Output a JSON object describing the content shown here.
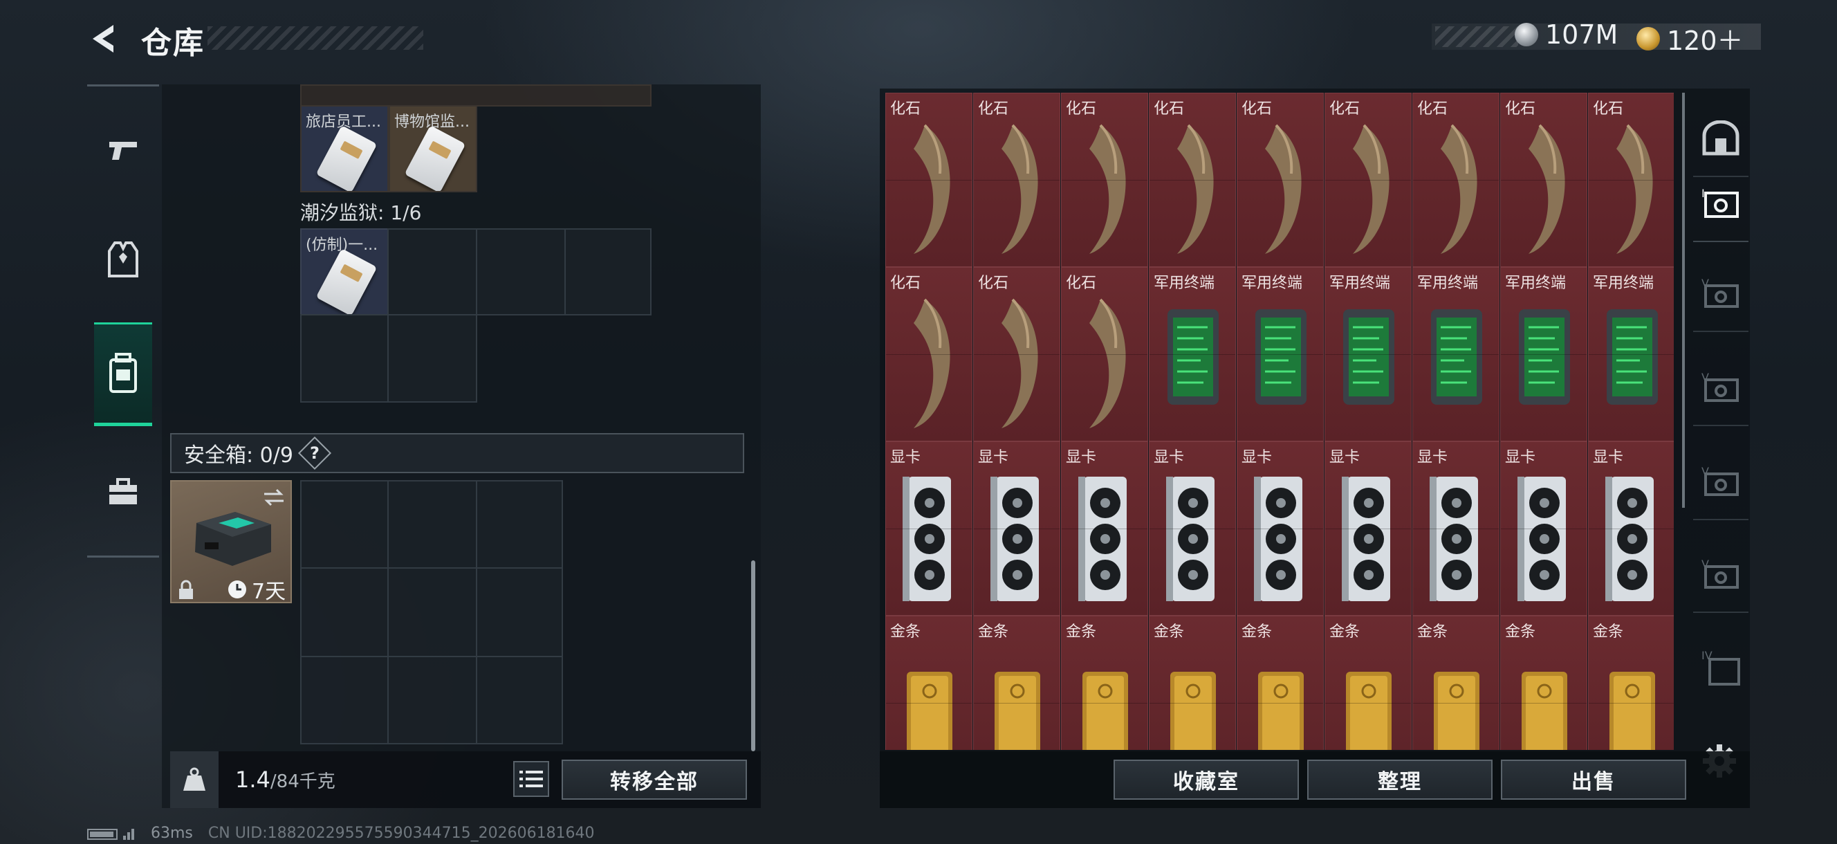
{
  "header": {
    "title": "仓库",
    "currencies": [
      {
        "icon": "silver-coin-icon",
        "value": "107M"
      },
      {
        "icon": "gold-coin-icon",
        "value": "120＋"
      }
    ]
  },
  "left_nav": {
    "items": [
      {
        "name": "weapon",
        "icon": "gun-icon",
        "active": false
      },
      {
        "name": "armor",
        "icon": "armor-vest-icon",
        "active": false
      },
      {
        "name": "backpack",
        "icon": "backpack-icon",
        "active": true
      },
      {
        "name": "toolbox",
        "icon": "toolbox-icon",
        "active": false
      }
    ]
  },
  "keycards": {
    "top_items": [
      {
        "label": "旅店员工..."
      },
      {
        "label": "博物馆监..."
      }
    ],
    "prison_section_label": "潮汐监狱: 1/6",
    "prison_items": [
      {
        "label": "(仿制)一..."
      }
    ]
  },
  "safe_box": {
    "label": "安全箱: 0/9",
    "help": "?",
    "duration": "7天"
  },
  "footer_left": {
    "weight_value": "1.4",
    "weight_capacity": "/84千克",
    "transfer_all": "转移全部"
  },
  "stash": {
    "items": [
      {
        "label": "化石",
        "type": "fossil"
      },
      {
        "label": "化石",
        "type": "fossil"
      },
      {
        "label": "化石",
        "type": "fossil"
      },
      {
        "label": "化石",
        "type": "fossil"
      },
      {
        "label": "化石",
        "type": "fossil"
      },
      {
        "label": "化石",
        "type": "fossil"
      },
      {
        "label": "化石",
        "type": "fossil"
      },
      {
        "label": "化石",
        "type": "fossil"
      },
      {
        "label": "化石",
        "type": "fossil"
      },
      {
        "label": "化石",
        "type": "fossil"
      },
      {
        "label": "化石",
        "type": "fossil"
      },
      {
        "label": "化石",
        "type": "fossil"
      },
      {
        "label": "军用终端",
        "type": "terminal"
      },
      {
        "label": "军用终端",
        "type": "terminal"
      },
      {
        "label": "军用终端",
        "type": "terminal"
      },
      {
        "label": "军用终端",
        "type": "terminal"
      },
      {
        "label": "军用终端",
        "type": "terminal"
      },
      {
        "label": "军用终端",
        "type": "terminal"
      },
      {
        "label": "显卡",
        "type": "gpu"
      },
      {
        "label": "显卡",
        "type": "gpu"
      },
      {
        "label": "显卡",
        "type": "gpu"
      },
      {
        "label": "显卡",
        "type": "gpu"
      },
      {
        "label": "显卡",
        "type": "gpu"
      },
      {
        "label": "显卡",
        "type": "gpu"
      },
      {
        "label": "显卡",
        "type": "gpu"
      },
      {
        "label": "显卡",
        "type": "gpu"
      },
      {
        "label": "显卡",
        "type": "gpu"
      },
      {
        "label": "金条",
        "type": "gold"
      },
      {
        "label": "金条",
        "type": "gold"
      },
      {
        "label": "金条",
        "type": "gold"
      },
      {
        "label": "金条",
        "type": "gold"
      },
      {
        "label": "金条",
        "type": "gold"
      },
      {
        "label": "金条",
        "type": "gold"
      },
      {
        "label": "金条",
        "type": "gold"
      },
      {
        "label": "金条",
        "type": "gold"
      },
      {
        "label": "金条",
        "type": "gold"
      }
    ]
  },
  "stash_tabs": [
    {
      "icon": "vault-icon",
      "active": false
    },
    {
      "icon": "stash-page-1-icon",
      "active": true
    },
    {
      "icon": "stash-page-v-icon",
      "active": false
    },
    {
      "icon": "stash-page-v-icon",
      "active": false
    },
    {
      "icon": "stash-page-v-icon",
      "active": false
    },
    {
      "icon": "stash-page-v-icon",
      "active": false
    },
    {
      "icon": "stash-page-iv-icon",
      "active": false
    }
  ],
  "footer_right": {
    "collection": "收藏室",
    "organize": "整理",
    "sell": "出售"
  },
  "status_bar": {
    "ping": "63ms",
    "uid": "CN UID:18820229557559034471​5_202606181640"
  }
}
